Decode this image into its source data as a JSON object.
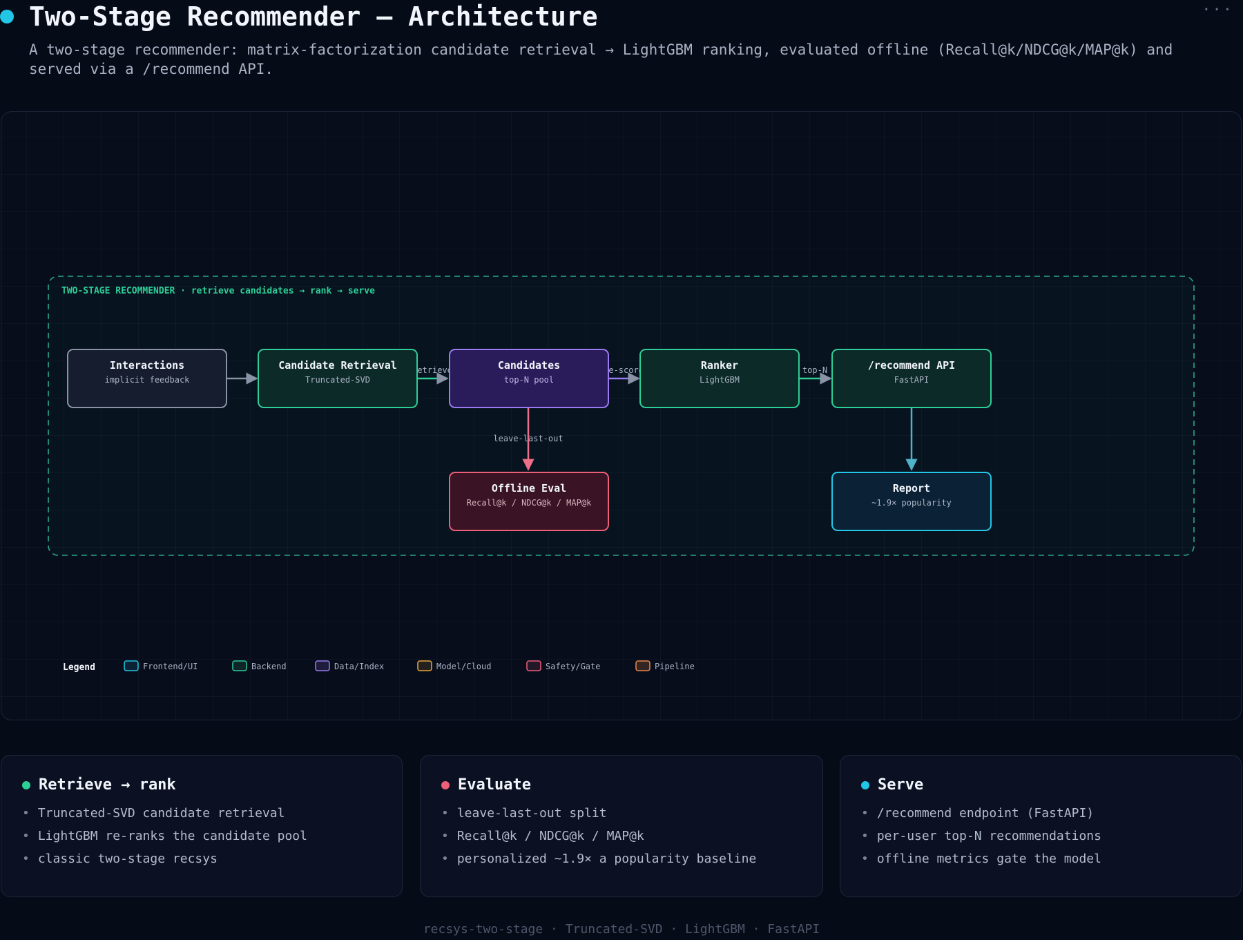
{
  "header": {
    "title": "Two-Stage Recommender — Architecture",
    "subtitle": "A two-stage recommender: matrix-factorization candidate retrieval → LightGBM ranking, evaluated offline (Recall@k/NDCG@k/MAP@k) and served via a /recommend API.",
    "menu": "···"
  },
  "diagram": {
    "group_label": "TWO-STAGE RECOMMENDER · retrieve candidates → rank → serve",
    "nodes": [
      {
        "id": "interactions",
        "title": "Interactions",
        "subtitle": "implicit feedback",
        "kind": "neutral"
      },
      {
        "id": "candidate-retrieval",
        "title": "Candidate Retrieval",
        "subtitle": "Truncated-SVD",
        "kind": "backend"
      },
      {
        "id": "candidates",
        "title": "Candidates",
        "subtitle": "top-N pool",
        "kind": "data"
      },
      {
        "id": "ranker",
        "title": "Ranker",
        "subtitle": "LightGBM",
        "kind": "backend"
      },
      {
        "id": "recommend-api",
        "title": "/recommend API",
        "subtitle": "FastAPI",
        "kind": "backend"
      },
      {
        "id": "offline-eval",
        "title": "Offline Eval",
        "subtitle": "Recall@k / NDCG@k / MAP@k",
        "kind": "safety"
      },
      {
        "id": "report",
        "title": "Report",
        "subtitle": "~1.9× popularity",
        "kind": "frontend"
      }
    ],
    "edges": [
      {
        "from": "interactions",
        "to": "candidate-retrieval",
        "label": ""
      },
      {
        "from": "candidate-retrieval",
        "to": "candidates",
        "label": "retrieve"
      },
      {
        "from": "candidates",
        "to": "ranker",
        "label": "re-score"
      },
      {
        "from": "ranker",
        "to": "recommend-api",
        "label": "top-N"
      },
      {
        "from": "candidates",
        "to": "offline-eval",
        "label": "leave-last-out"
      },
      {
        "from": "recommend-api",
        "to": "report",
        "label": ""
      }
    ],
    "legend": {
      "title": "Legend",
      "items": [
        {
          "label": "Frontend/UI",
          "color": "#22c7e6"
        },
        {
          "label": "Backend",
          "color": "#2ecf96"
        },
        {
          "label": "Data/Index",
          "color": "#9a7cf0"
        },
        {
          "label": "Model/Cloud",
          "color": "#e8a93a"
        },
        {
          "label": "Safety/Gate",
          "color": "#ee5f78"
        },
        {
          "label": "Pipeline",
          "color": "#e8884a"
        }
      ]
    }
  },
  "cards": [
    {
      "title": "Retrieve → rank",
      "dot_color": "#2ecf96",
      "items": [
        "Truncated-SVD candidate retrieval",
        "LightGBM re-ranks the candidate pool",
        "classic two-stage recsys"
      ]
    },
    {
      "title": "Evaluate",
      "dot_color": "#ee5f78",
      "items": [
        "leave-last-out split",
        "Recall@k / NDCG@k / MAP@k",
        "personalized ~1.9× a popularity baseline"
      ]
    },
    {
      "title": "Serve",
      "dot_color": "#22c7e6",
      "items": [
        "/recommend endpoint (FastAPI)",
        "per-user top-N recommendations",
        "offline metrics gate the model"
      ]
    }
  ],
  "footer": "recsys-two-stage · Truncated-SVD · LightGBM · FastAPI"
}
